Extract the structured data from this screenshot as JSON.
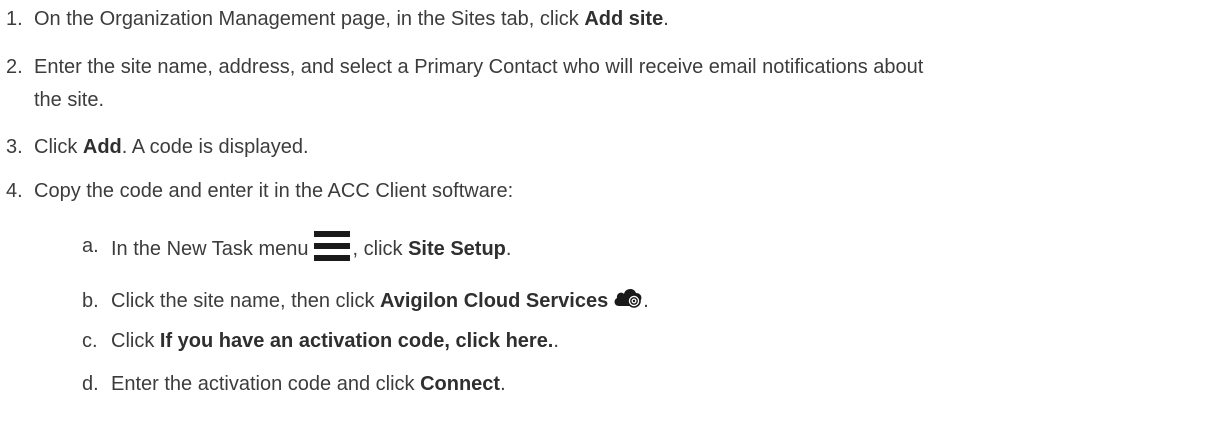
{
  "steps": [
    {
      "num": "1.",
      "pre": "On the Organization Management page, in the Sites tab, click ",
      "bold": "Add site",
      "post": "."
    },
    {
      "num": "2.",
      "line1": "Enter the site name, address, and select a Primary Contact who will receive email notifications about",
      "line2": "the site."
    },
    {
      "num": "3.",
      "pre": "Click ",
      "bold": "Add",
      "post": ". A code is displayed."
    },
    {
      "num": "4.",
      "text": "Copy the code and enter it in the ACC Client software:"
    }
  ],
  "substeps": [
    {
      "num": "a.",
      "pre": "In the New Task menu",
      "mid": ", click ",
      "bold": "Site Setup",
      "post": ".",
      "icon": "hamburger-menu-icon"
    },
    {
      "num": "b.",
      "pre": "Click the site name, then click ",
      "bold": "Avigilon Cloud Services",
      "post": ".",
      "icon": "cloud-services-icon"
    },
    {
      "num": "c.",
      "pre": "Click ",
      "bold": "If you have an activation code, click here.",
      "post": "."
    },
    {
      "num": "d.",
      "pre": "Enter the activation code and click ",
      "bold": "Connect",
      "post": "."
    }
  ]
}
